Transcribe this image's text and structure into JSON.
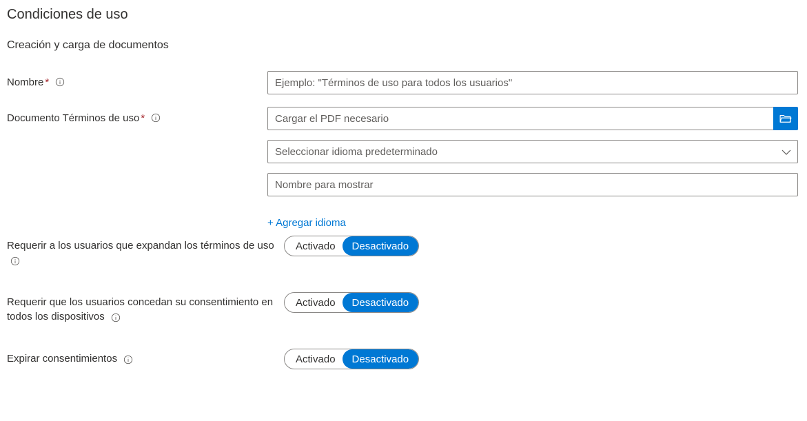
{
  "page_title": "Condiciones de uso",
  "section_title": "Creación y carga de documentos",
  "fields": {
    "name": {
      "label": "Nombre",
      "placeholder": "Ejemplo: \"Términos de uso para todos los usuarios\""
    },
    "document": {
      "label": "Documento Términos de uso",
      "upload_placeholder": "Cargar el PDF necesario",
      "language_placeholder": "Seleccionar idioma predeterminado",
      "display_name_placeholder": "Nombre para mostrar"
    },
    "add_language": "+ Agregar idioma"
  },
  "toggles": {
    "on_label": "Activado",
    "off_label": "Desactivado",
    "expand_terms": {
      "label": "Requerir a los usuarios que expandan los términos de uso",
      "value": "off"
    },
    "consent_all_devices": {
      "label": "Requerir que los usuarios concedan su consentimiento en todos los dispositivos",
      "value": "off"
    },
    "expire_consents": {
      "label": "Expirar consentimientos",
      "value": "off"
    }
  }
}
